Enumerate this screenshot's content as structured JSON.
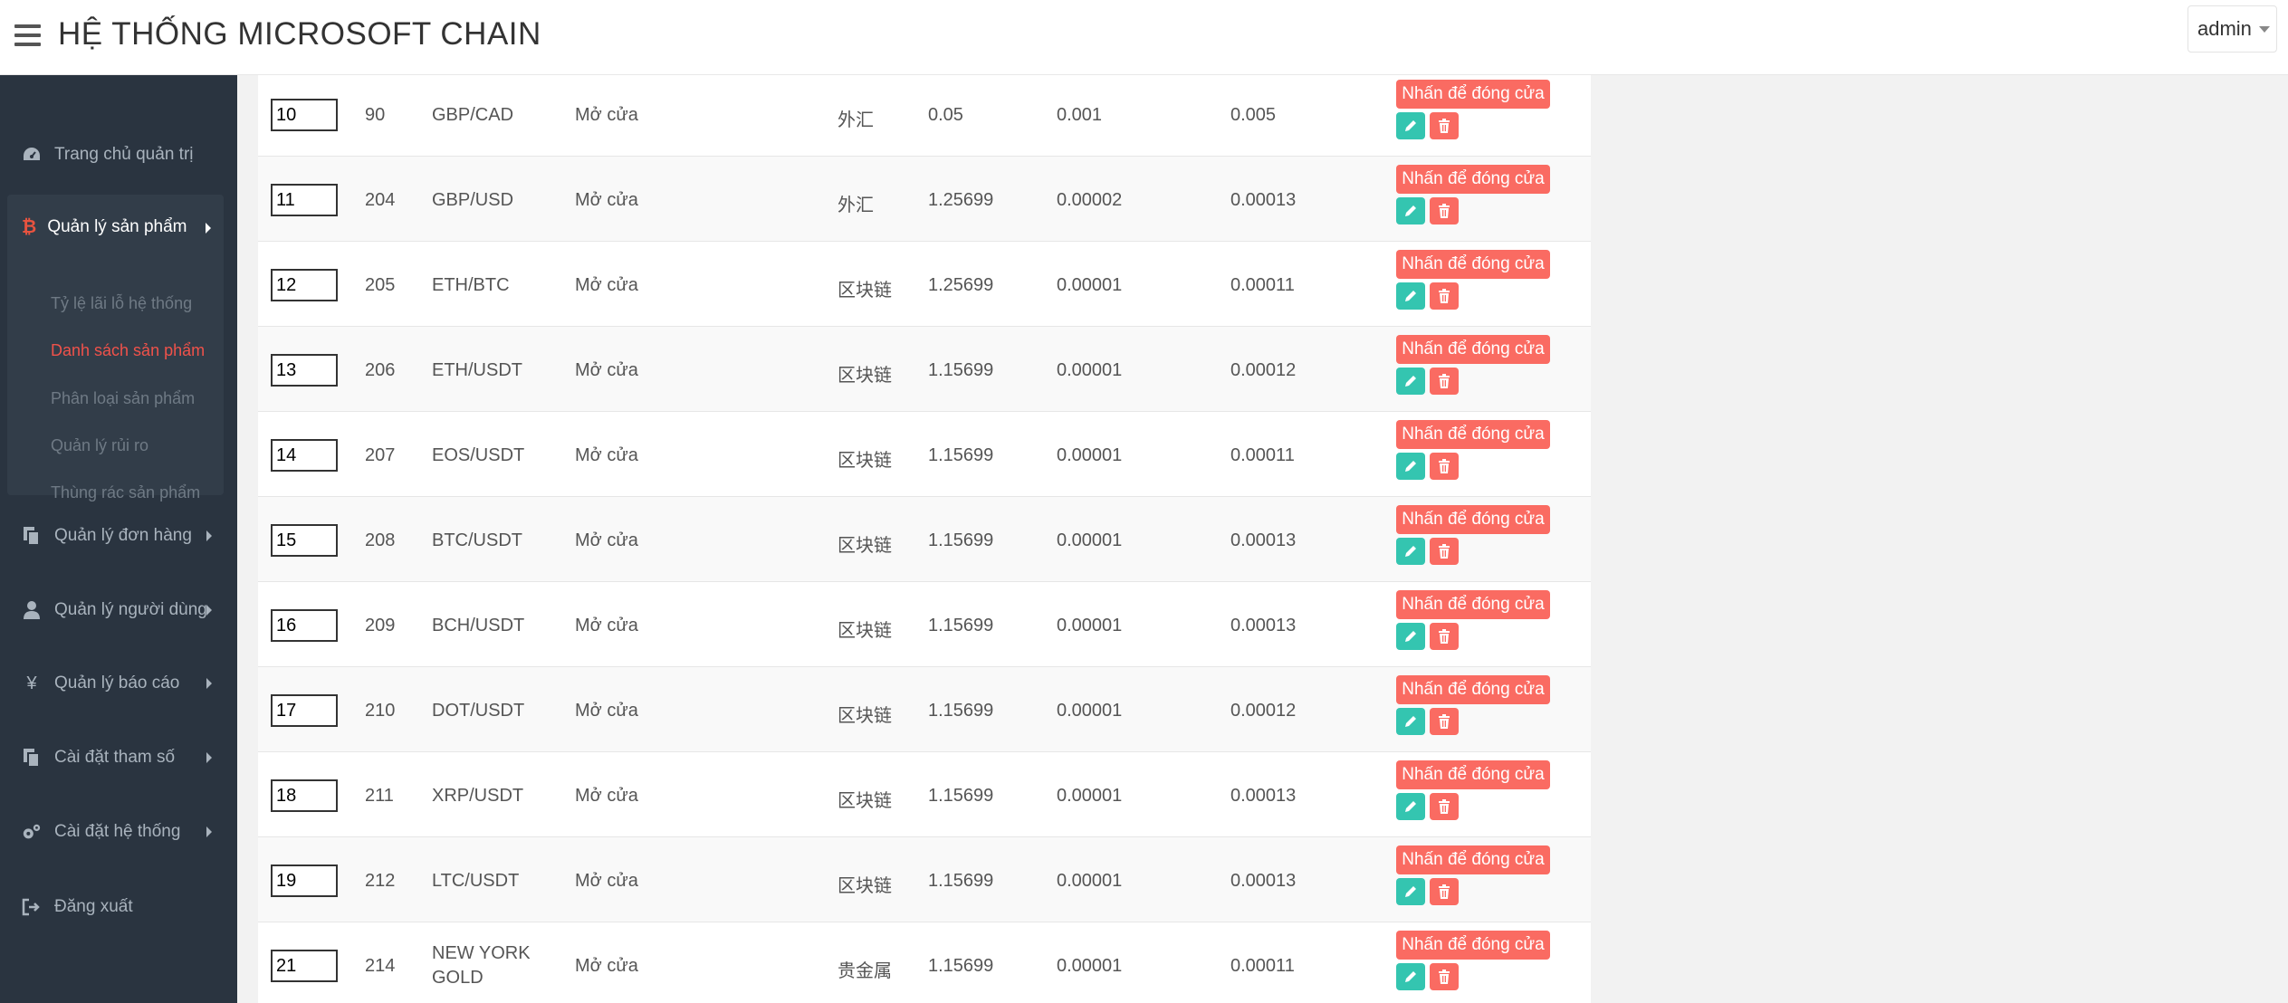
{
  "header": {
    "title": "HỆ THỐNG MICROSOFT CHAIN",
    "user": "admin"
  },
  "sidebar": {
    "items": [
      {
        "label": "Trang chủ quản trị",
        "icon": "dashboard-icon"
      },
      {
        "label": "Quản lý sản phẩm",
        "icon": "bitcoin-icon",
        "expanded": true,
        "children": [
          {
            "label": "Tỷ lệ lãi lỗ hệ thống",
            "active": false
          },
          {
            "label": "Danh sách sản phẩm",
            "active": true
          },
          {
            "label": "Phân loại sản phẩm",
            "active": false
          },
          {
            "label": "Quản lý rủi ro",
            "active": false
          },
          {
            "label": "Thùng rác sản phẩm",
            "active": false
          }
        ]
      },
      {
        "label": "Quản lý đơn hàng",
        "icon": "copy-icon"
      },
      {
        "label": "Quản lý người dùng",
        "icon": "user-icon"
      },
      {
        "label": "Quản lý báo cáo",
        "icon": "yen-icon"
      },
      {
        "label": "Cài đặt tham số",
        "icon": "copy-icon"
      },
      {
        "label": "Cài đặt hệ thống",
        "icon": "gears-icon"
      },
      {
        "label": "Đăng xuất",
        "icon": "sign-out-icon"
      }
    ]
  },
  "colors": {
    "accent_red": "#fa6b62",
    "accent_teal": "#34c5b0",
    "sidebar_bg": "#2a3440",
    "active_link": "#f0524a"
  },
  "table": {
    "rows": [
      {
        "sort": "10",
        "id": "90",
        "name": "GBP/CAD",
        "status": "Mở cửa",
        "category": "外汇",
        "price": "0.05",
        "min": "0.001",
        "max": "0.005",
        "action": "Nhấn để đóng cửa"
      },
      {
        "sort": "11",
        "id": "204",
        "name": "GBP/USD",
        "status": "Mở cửa",
        "category": "外汇",
        "price": "1.25699",
        "min": "0.00002",
        "max": "0.00013",
        "action": "Nhấn để đóng cửa"
      },
      {
        "sort": "12",
        "id": "205",
        "name": "ETH/BTC",
        "status": "Mở cửa",
        "category": "区块链",
        "price": "1.25699",
        "min": "0.00001",
        "max": "0.00011",
        "action": "Nhấn để đóng cửa"
      },
      {
        "sort": "13",
        "id": "206",
        "name": "ETH/USDT",
        "status": "Mở cửa",
        "category": "区块链",
        "price": "1.15699",
        "min": "0.00001",
        "max": "0.00012",
        "action": "Nhấn để đóng cửa"
      },
      {
        "sort": "14",
        "id": "207",
        "name": "EOS/USDT",
        "status": "Mở cửa",
        "category": "区块链",
        "price": "1.15699",
        "min": "0.00001",
        "max": "0.00011",
        "action": "Nhấn để đóng cửa"
      },
      {
        "sort": "15",
        "id": "208",
        "name": "BTC/USDT",
        "status": "Mở cửa",
        "category": "区块链",
        "price": "1.15699",
        "min": "0.00001",
        "max": "0.00013",
        "action": "Nhấn để đóng cửa"
      },
      {
        "sort": "16",
        "id": "209",
        "name": "BCH/USDT",
        "status": "Mở cửa",
        "category": "区块链",
        "price": "1.15699",
        "min": "0.00001",
        "max": "0.00013",
        "action": "Nhấn để đóng cửa"
      },
      {
        "sort": "17",
        "id": "210",
        "name": "DOT/USDT",
        "status": "Mở cửa",
        "category": "区块链",
        "price": "1.15699",
        "min": "0.00001",
        "max": "0.00012",
        "action": "Nhấn để đóng cửa"
      },
      {
        "sort": "18",
        "id": "211",
        "name": "XRP/USDT",
        "status": "Mở cửa",
        "category": "区块链",
        "price": "1.15699",
        "min": "0.00001",
        "max": "0.00013",
        "action": "Nhấn để đóng cửa"
      },
      {
        "sort": "19",
        "id": "212",
        "name": "LTC/USDT",
        "status": "Mở cửa",
        "category": "区块链",
        "price": "1.15699",
        "min": "0.00001",
        "max": "0.00013",
        "action": "Nhấn để đóng cửa"
      },
      {
        "sort": "21",
        "id": "214",
        "name": "NEW YORK GOLD",
        "status": "Mở cửa",
        "category": "贵金属",
        "price": "1.15699",
        "min": "0.00001",
        "max": "0.00011",
        "action": "Nhấn để đóng cửa"
      }
    ]
  }
}
